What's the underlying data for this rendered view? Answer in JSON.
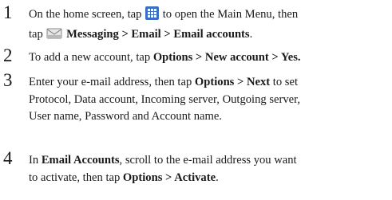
{
  "steps": [
    {
      "number": "1",
      "line1_pre": "On the home screen, tap ",
      "line1_post": " to open the Main Menu, then",
      "line2_pre": "tap ",
      "line2_bold": "Messaging > Email > Email accounts",
      "line2_post": ".",
      "icons": [
        "main-menu-grid-icon",
        "messaging-envelope-icon"
      ]
    },
    {
      "number": "2",
      "text_pre": "To add a new account, tap ",
      "text_bold": "Options > New account > Yes."
    },
    {
      "number": "3",
      "line1_pre": "Enter your e-mail address, then tap ",
      "line1_bold": "Options > Next",
      "line1_post": " to set",
      "line2": "Protocol, Data account, Incoming server, Outgoing server,",
      "line3": "User name, Password and Account name."
    },
    {
      "number": "4",
      "line1_pre": "In ",
      "line1_bold": "Email Accounts",
      "line1_post": ", scroll to the e-mail address you want",
      "line2_pre": "to activate, then tap ",
      "line2_bold": "Options > Activate",
      "line2_post": "."
    }
  ],
  "colors": {
    "text": "#1a1a1a",
    "menu_icon_fill": "#3b6fc4"
  }
}
